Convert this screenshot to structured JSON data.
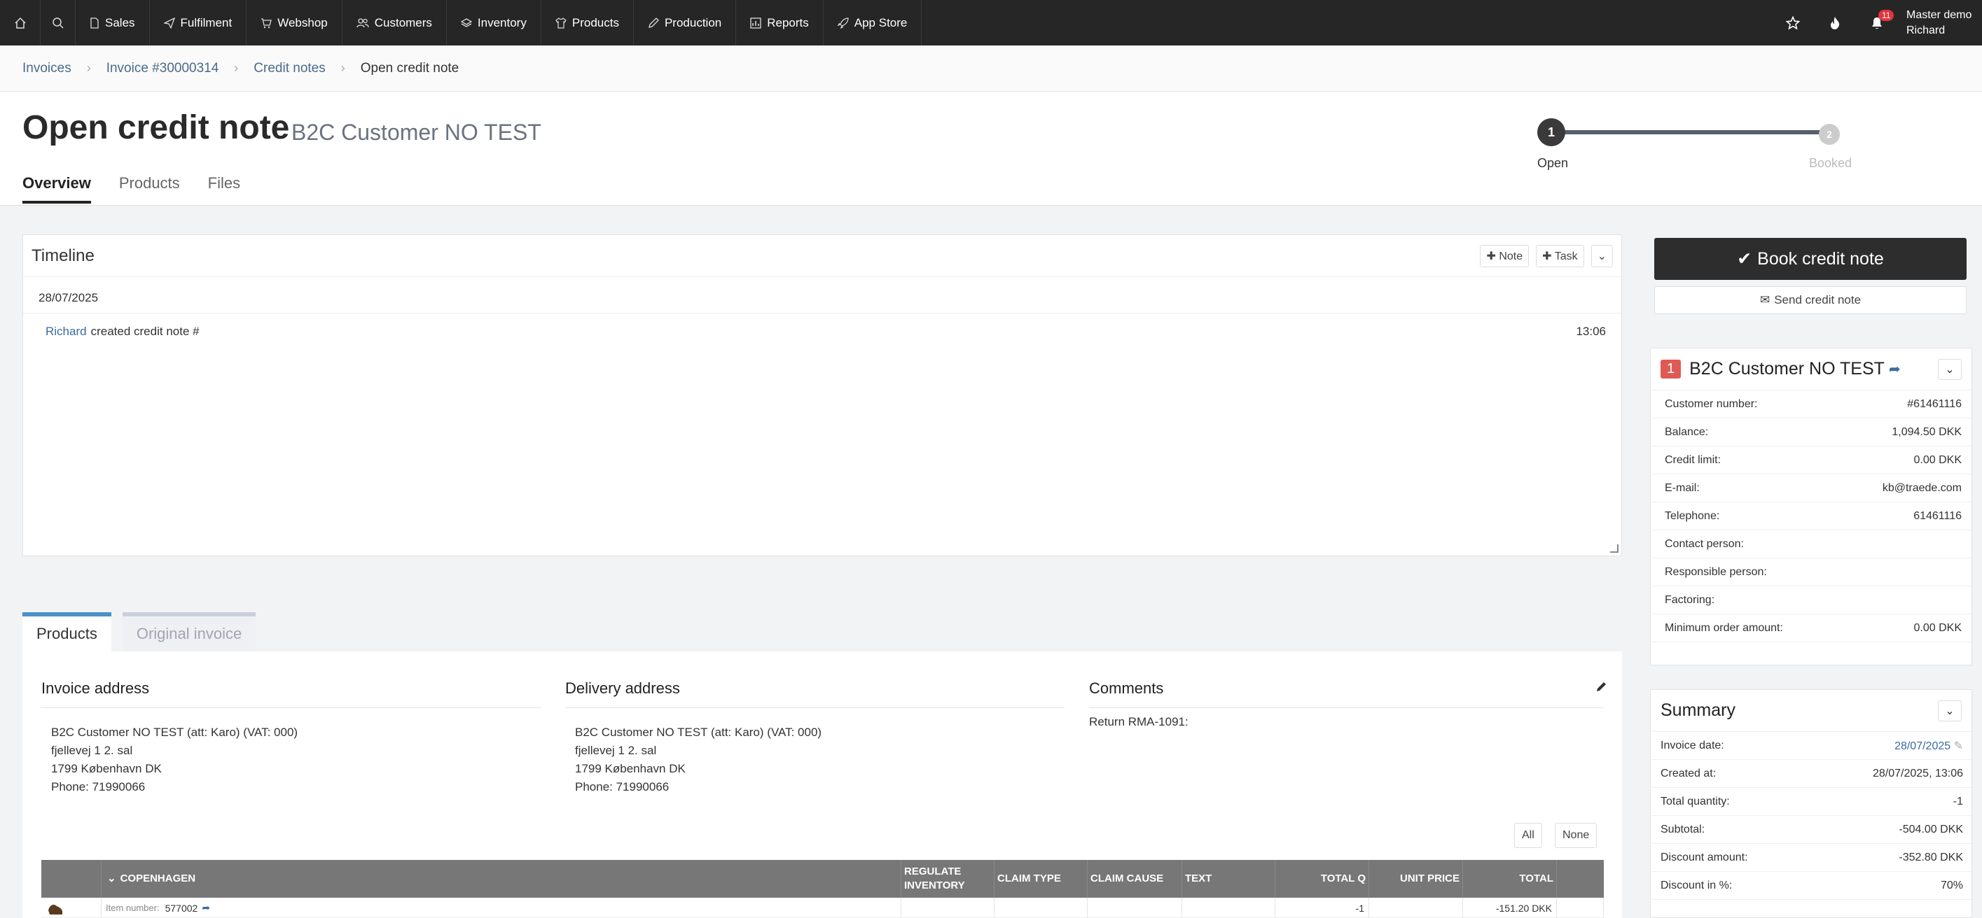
{
  "nav": {
    "items": [
      {
        "label": "Sales",
        "icon": "document-icon"
      },
      {
        "label": "Fulfilment",
        "icon": "send-icon"
      },
      {
        "label": "Webshop",
        "icon": "cart-icon"
      },
      {
        "label": "Customers",
        "icon": "users-icon"
      },
      {
        "label": "Inventory",
        "icon": "layers-icon"
      },
      {
        "label": "Products",
        "icon": "shirt-icon"
      },
      {
        "label": "Production",
        "icon": "pencil-icon"
      },
      {
        "label": "Reports",
        "icon": "chart-icon"
      },
      {
        "label": "App Store",
        "icon": "rocket-icon"
      }
    ],
    "notification_count": "11",
    "user_line1": "Master demo",
    "user_line2": "Richard"
  },
  "breadcrumb": {
    "items": [
      "Invoices",
      "Invoice #30000314",
      "Credit notes"
    ],
    "current": "Open credit note"
  },
  "header": {
    "title": "Open credit note",
    "subtitle": "B2C Customer NO TEST",
    "tabs": [
      "Overview",
      "Products",
      "Files"
    ],
    "steps": [
      {
        "number": "1",
        "label": "Open"
      },
      {
        "number": "2",
        "label": "Booked"
      }
    ]
  },
  "timeline": {
    "title": "Timeline",
    "note_label": "Note",
    "task_label": "Task",
    "date": "28/07/2025",
    "entry": {
      "user": "Richard",
      "text": "created credit note #",
      "time": "13:06"
    }
  },
  "product_tabs": [
    "Products",
    "Original invoice"
  ],
  "invoice_address": {
    "title": "Invoice address",
    "lines": [
      "B2C Customer NO TEST (att: Karo) (VAT: 000)",
      "fjellevej 1 2. sal",
      "1799 København DK",
      "Phone: 71990066"
    ]
  },
  "delivery_address": {
    "title": "Delivery address",
    "lines": [
      "B2C Customer NO TEST (att: Karo) (VAT: 000)",
      "fjellevej 1 2. sal",
      "1799 København DK",
      "Phone: 71990066"
    ]
  },
  "comments": {
    "title": "Comments",
    "text": "Return RMA-1091:"
  },
  "select_all": "All",
  "select_none": "None",
  "table": {
    "group": "COPENHAGEN",
    "columns": [
      "REGULATE INVENTORY",
      "CLAIM TYPE",
      "CLAIM CAUSE",
      "TEXT",
      "TOTAL Q",
      "UNIT PRICE",
      "TOTAL"
    ],
    "row": {
      "item_label": "Item number:",
      "item_number": "577002",
      "total_q": "-1",
      "total": "-151.20 DKK"
    }
  },
  "actions": {
    "book": "Book credit note",
    "send": "Send credit note"
  },
  "customer": {
    "number_badge": "1",
    "name": "B2C Customer NO TEST",
    "fields": [
      {
        "label": "Customer number:",
        "value": "#61461116"
      },
      {
        "label": "Balance:",
        "value": "1,094.50 DKK"
      },
      {
        "label": "Credit limit:",
        "value": "0.00 DKK"
      },
      {
        "label": "E-mail:",
        "value": "kb@traede.com"
      },
      {
        "label": "Telephone:",
        "value": "61461116"
      },
      {
        "label": "Contact person:",
        "value": ""
      },
      {
        "label": "Responsible person:",
        "value": ""
      },
      {
        "label": "Factoring:",
        "value": ""
      },
      {
        "label": "Minimum order amount:",
        "value": "0.00 DKK"
      }
    ]
  },
  "summary": {
    "title": "Summary",
    "fields": [
      {
        "label": "Invoice date:",
        "value": "28/07/2025"
      },
      {
        "label": "Created at:",
        "value": "28/07/2025, 13:06"
      },
      {
        "label": "Total quantity:",
        "value": "-1"
      },
      {
        "label": "Subtotal:",
        "value": "-504.00 DKK"
      },
      {
        "label": "Discount amount:",
        "value": "-352.80 DKK"
      },
      {
        "label": "Discount in %:",
        "value": "70%"
      }
    ]
  }
}
